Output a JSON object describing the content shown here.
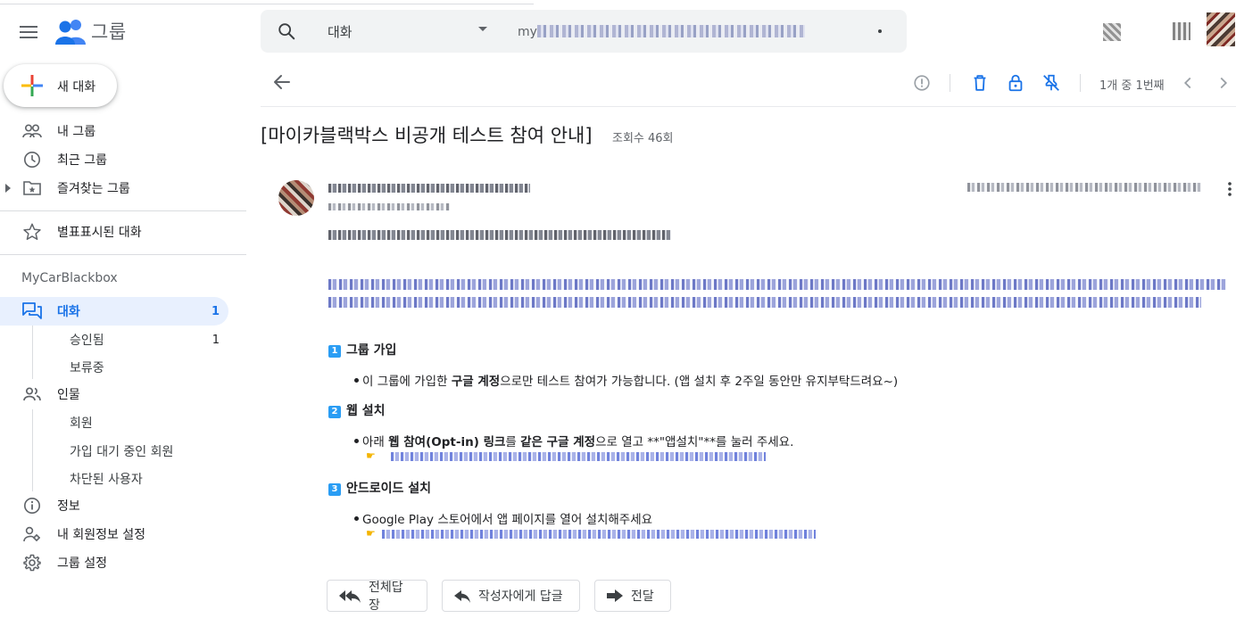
{
  "app": {
    "name": "그룹"
  },
  "search": {
    "scope": "대화",
    "query_visible": "my"
  },
  "sidebar": {
    "new_chat": "새 대화",
    "items": {
      "my_groups": "내 그룹",
      "recent_groups": "최근 그룹",
      "favorite_groups": "즐겨찾는 그룹",
      "starred": "별표표시된 대화"
    },
    "group_name": "MyCarBlackbox",
    "conversations": {
      "label": "대화",
      "count": "1"
    },
    "approved": {
      "label": "승인됨",
      "count": "1"
    },
    "pending": {
      "label": "보류중"
    },
    "people": {
      "label": "인물"
    },
    "members": {
      "label": "회원"
    },
    "waiting_members": {
      "label": "가입 대기 중인 회원"
    },
    "blocked_users": {
      "label": "차단된 사용자"
    },
    "info": {
      "label": "정보"
    },
    "my_membership": {
      "label": "내 회원정보 설정"
    },
    "group_settings": {
      "label": "그룹 설정"
    }
  },
  "toolbar": {
    "pager": "1개 중 1번째"
  },
  "thread": {
    "title": "[마이카블랙박스 비공개 테스트 참여 안내]",
    "views": "조회수 46회",
    "body": {
      "step1": {
        "number": "1",
        "heading": "그룹 가입",
        "text_pre": "이 그룹에 가입한 ",
        "text_bold": "구글 계정",
        "text_post": "으로만 테스트 참여가 가능합니다. (앱 설치 후 2주일 동안만 유지부탁드려요~)"
      },
      "step2": {
        "number": "2",
        "heading": "웹 설치",
        "text_pre": "아래 ",
        "text_bold1": "웹 참여(Opt-in) 링크",
        "text_mid": "를 ",
        "text_bold2": "같은 구글 계정",
        "text_post": "으로 열고 **\"앱설치\"**를 눌러 주세요."
      },
      "step3": {
        "number": "3",
        "heading": "안드로이드 설치",
        "text": "Google Play 스토어에서 앱 페이지를 열어 설치해주세요"
      }
    }
  },
  "actions": {
    "reply_all": "전체답장",
    "reply_author": "작성자에게 답글",
    "forward": "전달"
  },
  "icons": {
    "menu": "menu-icon",
    "search": "search-icon",
    "report": "report-icon",
    "delete": "trash-icon",
    "lock": "lock-icon",
    "unpin": "unpin-icon",
    "back": "back-arrow-icon"
  },
  "colors": {
    "accent": "#1a73e8",
    "active_bg": "#e8f0fe",
    "badge": "#2a9df4"
  }
}
